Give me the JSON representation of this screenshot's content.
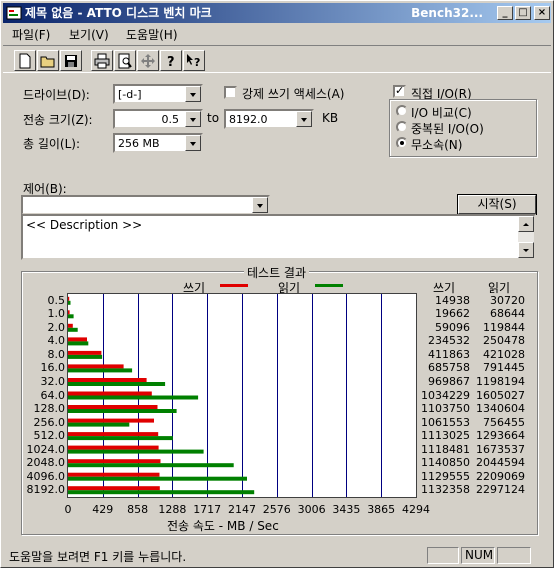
{
  "window": {
    "title": "제목 없음 - ATTO 디스크 벤치 마크",
    "title_right": "Bench32...",
    "min_label": "_",
    "max_label": "□",
    "close_label": "×"
  },
  "menu": [
    "파일(F)",
    "보기(V)",
    "도움말(H)"
  ],
  "toolbar": [
    "new-file-icon",
    "open-folder-icon",
    "save-icon",
    "print-icon",
    "print-preview-icon",
    "move-icon",
    "help-icon",
    "context-help-icon"
  ],
  "controls": {
    "drive_label": "드라이브(D):",
    "drive_value": "[-d-]",
    "force_write_label": "강제 쓰기 액세스(A)",
    "transfer_label": "전송 크기(Z):",
    "transfer_from": "0.5",
    "to_label": "to",
    "transfer_to": "8192.0",
    "kb_label": "KB",
    "total_label": "총 길이(L):",
    "total_value": "256 MB",
    "direct_io_label": "직접 I/O(R)",
    "direct_io_checked": true,
    "io_compare": "I/O 비교(C)",
    "overlapped_io": "중복된 I/O(O)",
    "neither": "무소속(N)",
    "control_label": "제어(B):",
    "control_value": "",
    "start_button": "시작(S)",
    "description": "<< Description >>"
  },
  "results": {
    "title": "테스트 결과",
    "write_legend": "쓰기",
    "read_legend": "읽기",
    "write_col": "쓰기",
    "read_col": "읽기",
    "xlabel": "전송 속도 - MB / Sec",
    "colors": {
      "write": "#e00000",
      "read": "#008000",
      "grid": "#000080"
    }
  },
  "chart_data": {
    "type": "bar",
    "categories": [
      "0.5",
      "1.0",
      "2.0",
      "4.0",
      "8.0",
      "16.0",
      "32.0",
      "64.0",
      "128.0",
      "256.0",
      "512.0",
      "1024.0",
      "2048.0",
      "4096.0",
      "8192.0"
    ],
    "series": [
      {
        "name": "쓰기",
        "values": [
          14938,
          19662,
          59096,
          234532,
          411863,
          685758,
          969867,
          1034229,
          1103750,
          1061553,
          1113025,
          1118481,
          1140850,
          1129555,
          1132358
        ]
      },
      {
        "name": "읽기",
        "values": [
          30720,
          68644,
          119844,
          250478,
          421028,
          791445,
          1198194,
          1605027,
          1340604,
          756455,
          1293664,
          1673537,
          2044594,
          2209069,
          2297124
        ]
      }
    ],
    "xticks": [
      "0",
      "429",
      "858",
      "1288",
      "1717",
      "2147",
      "2576",
      "3006",
      "3435",
      "3865",
      "4294"
    ],
    "xlim": [
      0,
      4294
    ],
    "xlabel": "전송 속도 - MB / Sec",
    "grid": true
  },
  "status": {
    "text": "도움말을 보려면 F1 키를 누릅니다.",
    "num": "NUM"
  }
}
